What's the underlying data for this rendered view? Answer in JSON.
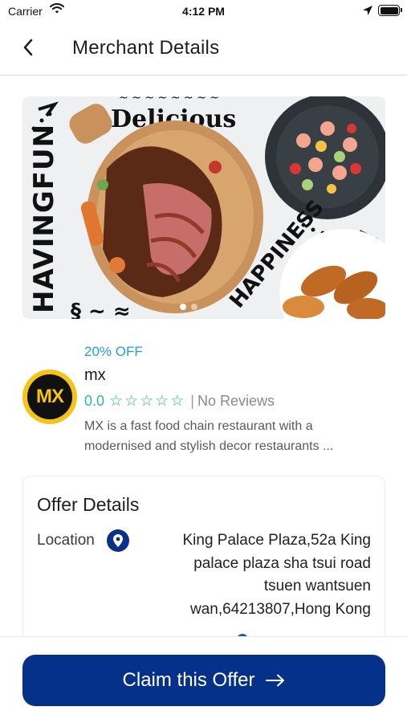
{
  "status_bar": {
    "carrier": "Carrier",
    "time": "4:12 PM",
    "icons": [
      "wifi-icon",
      "location-arrow-icon",
      "battery-icon"
    ]
  },
  "nav": {
    "title": "Merchant Details",
    "back_icon": "chevron-left-icon"
  },
  "banner": {
    "texts": [
      "Delicious",
      "HAVINGFUN",
      "HAPPINESS"
    ],
    "page_indicator": {
      "count": 2,
      "active": 1
    }
  },
  "merchant": {
    "discount": "20% OFF",
    "logo_text": "MX",
    "name": "mx",
    "rating_value": "0.0",
    "star_count": 5,
    "reviews_separator": "|",
    "reviews_text": "No Reviews",
    "description": "MX is a fast food chain restaurant  with a modernised and stylish decor restaurants ..."
  },
  "offer_details": {
    "title": "Offer Details",
    "location_label": "Location",
    "location_icon": "map-pin-icon",
    "address": "King Palace Plaza,52a King palace plaza sha tsui road tsuen wantsuen wan,64213807,Hong Kong"
  },
  "cta": {
    "label": "Claim this Offer",
    "icon": "arrow-right-icon"
  },
  "colors": {
    "primary": "#06318a",
    "accent_teal": "#2fb7a4",
    "discount_blue": "#1f9fd8",
    "logo_yellow": "#f5c416"
  }
}
